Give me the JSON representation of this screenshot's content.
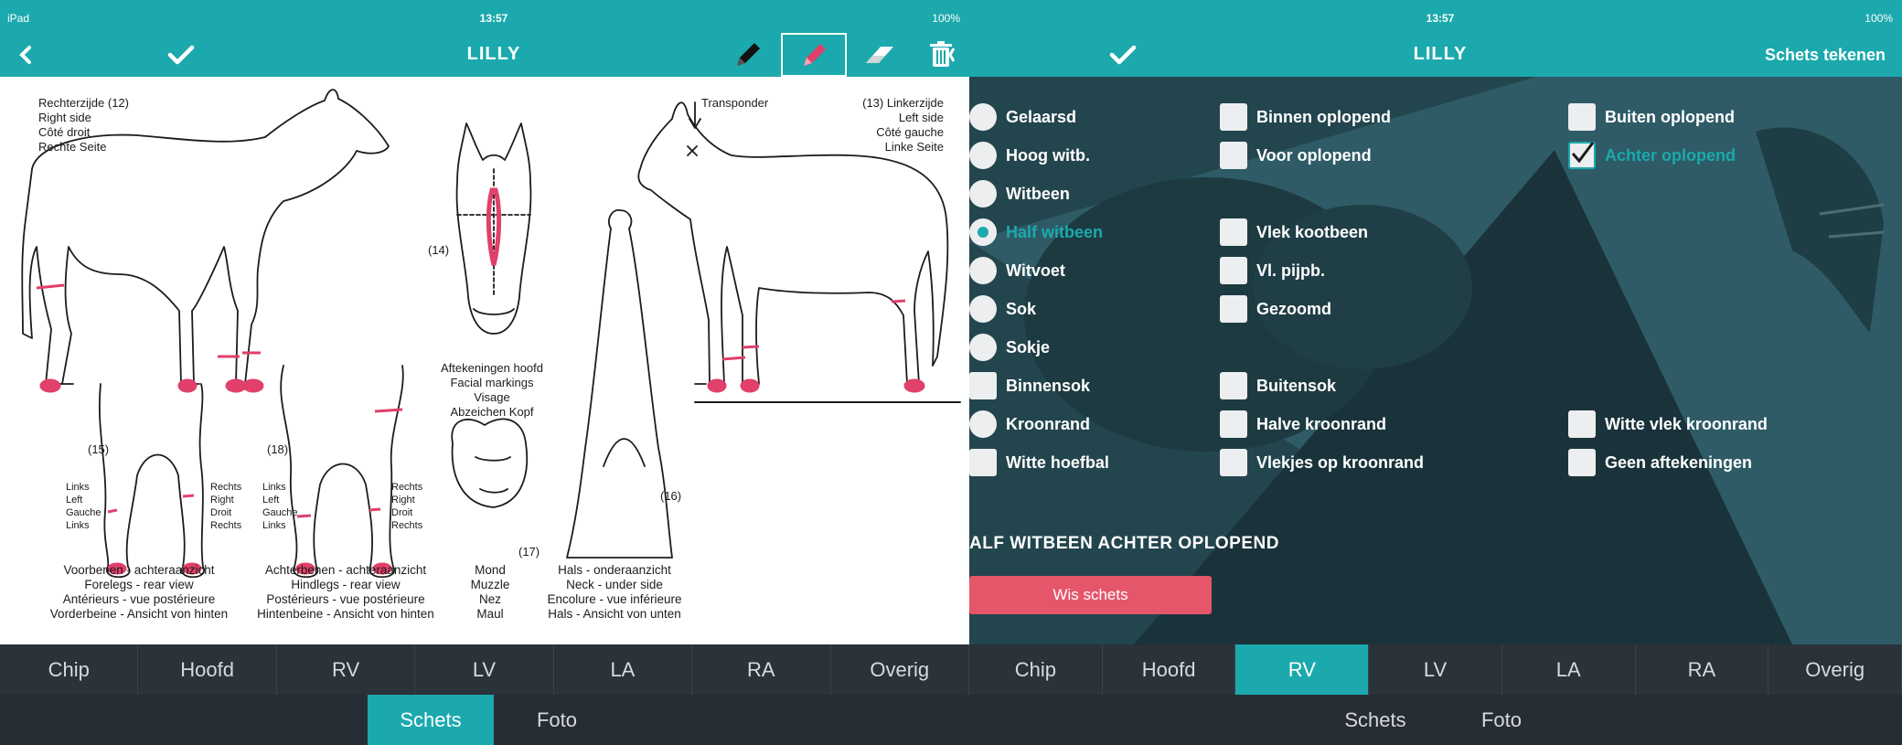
{
  "left": {
    "status": {
      "device": "iPad",
      "time": "13:57",
      "battery": "100%"
    },
    "nav": {
      "title": "LILLY"
    },
    "sketch": {
      "right_side": [
        "Rechterzijde  (12)",
        "Right side",
        "Côté droit",
        "Rechte Seite"
      ],
      "left_side": [
        "(13)  Linkerzijde",
        "Left side",
        "Côté gauche",
        "Linke Seite"
      ],
      "transponder": "Transponder",
      "head_num": "(14)",
      "facial": [
        "Aftekeningen hoofd",
        "Facial markings",
        "Visage",
        "Abzeichen Kopf"
      ],
      "num15": "(15)",
      "num16": "(16)",
      "num17": "(17)",
      "num18": "(18)",
      "fore_links": [
        "Links",
        "Left",
        "Gauche",
        "Links"
      ],
      "fore_rechts": [
        "Rechts",
        "Right",
        "Droit",
        "Rechts"
      ],
      "hind_links": [
        "Links",
        "Left",
        "Gauche",
        "Links"
      ],
      "hind_rechts": [
        "Rechts",
        "Right",
        "Droit",
        "Rechts"
      ],
      "caption_fore": [
        "Voorbenen - achteraanzicht",
        "Forelegs - rear view",
        "Antérieurs - vue postérieure",
        "Vorderbeine - Ansicht von hinten"
      ],
      "caption_hind": [
        "Achterbenen - achteraanzicht",
        "Hindlegs - rear view",
        "Postérieurs - vue postérieure",
        "Hintenbeine - Ansicht von hinten"
      ],
      "caption_mouth": [
        "Mond",
        "Muzzle",
        "Nez",
        "Maul"
      ],
      "caption_neck": [
        "Hals - onderaanzicht",
        "Neck - under side",
        "Encolure - vue inférieure",
        "Hals - Ansicht von unten"
      ]
    },
    "tabs": [
      "Chip",
      "Hoofd",
      "RV",
      "LV",
      "LA",
      "RA",
      "Overig"
    ],
    "subtabs": [
      "Schets",
      "Foto"
    ]
  },
  "right": {
    "status": {
      "time": "13:57",
      "battery": "100%"
    },
    "nav": {
      "title": "LILLY",
      "action": "Schets tekenen"
    },
    "col1": [
      {
        "label": "Gelaarsd",
        "type": "radio",
        "selected": false
      },
      {
        "label": "Hoog witb.",
        "type": "radio",
        "selected": false
      },
      {
        "label": "Witbeen",
        "type": "radio",
        "selected": false
      },
      {
        "label": "Half witbeen",
        "type": "radio",
        "selected": true
      },
      {
        "label": "Witvoet",
        "type": "radio",
        "selected": false
      },
      {
        "label": "Sok",
        "type": "radio",
        "selected": false
      },
      {
        "label": "Sokje",
        "type": "radio",
        "selected": false
      },
      {
        "label": "Binnensok",
        "type": "checkbox",
        "selected": false
      },
      {
        "label": "Kroonrand",
        "type": "radio",
        "selected": false
      },
      {
        "label": "Witte hoefbal",
        "type": "checkbox",
        "selected": false
      }
    ],
    "col2": [
      {
        "label": "Binnen oplopend",
        "row": 0,
        "selected": false
      },
      {
        "label": "Voor oplopend",
        "row": 1,
        "selected": false
      },
      {
        "label": "Vlek kootbeen",
        "row": 3,
        "selected": false
      },
      {
        "label": "Vl. pijpb.",
        "row": 4,
        "selected": false
      },
      {
        "label": "Gezoomd",
        "row": 5,
        "selected": false
      },
      {
        "label": "Buitensok",
        "row": 7,
        "selected": false
      },
      {
        "label": "Halve kroonrand",
        "row": 8,
        "selected": false
      },
      {
        "label": "Vlekjes op kroonrand",
        "row": 9,
        "selected": false
      }
    ],
    "col3": [
      {
        "label": "Buiten oplopend",
        "row": 0,
        "selected": false
      },
      {
        "label": "Achter oplopend",
        "row": 1,
        "selected": true
      },
      {
        "label": "Witte vlek kroonrand",
        "row": 8,
        "selected": false
      },
      {
        "label": "Geen aftekeningen",
        "row": 9,
        "selected": false
      }
    ],
    "summary": "ALF WITBEEN ACHTER OPLOPEND",
    "clear_button": "Wis schets",
    "tabs": [
      "Chip",
      "Hoofd",
      "RV",
      "LV",
      "LA",
      "RA",
      "Overig"
    ],
    "subtabs": [
      "Schets",
      "Foto"
    ]
  },
  "colors": {
    "teal": "#1ba9ad",
    "dark_bar": "#2a323a",
    "sketch_marking": "#e0406a",
    "clear_button": "#e5566b"
  }
}
